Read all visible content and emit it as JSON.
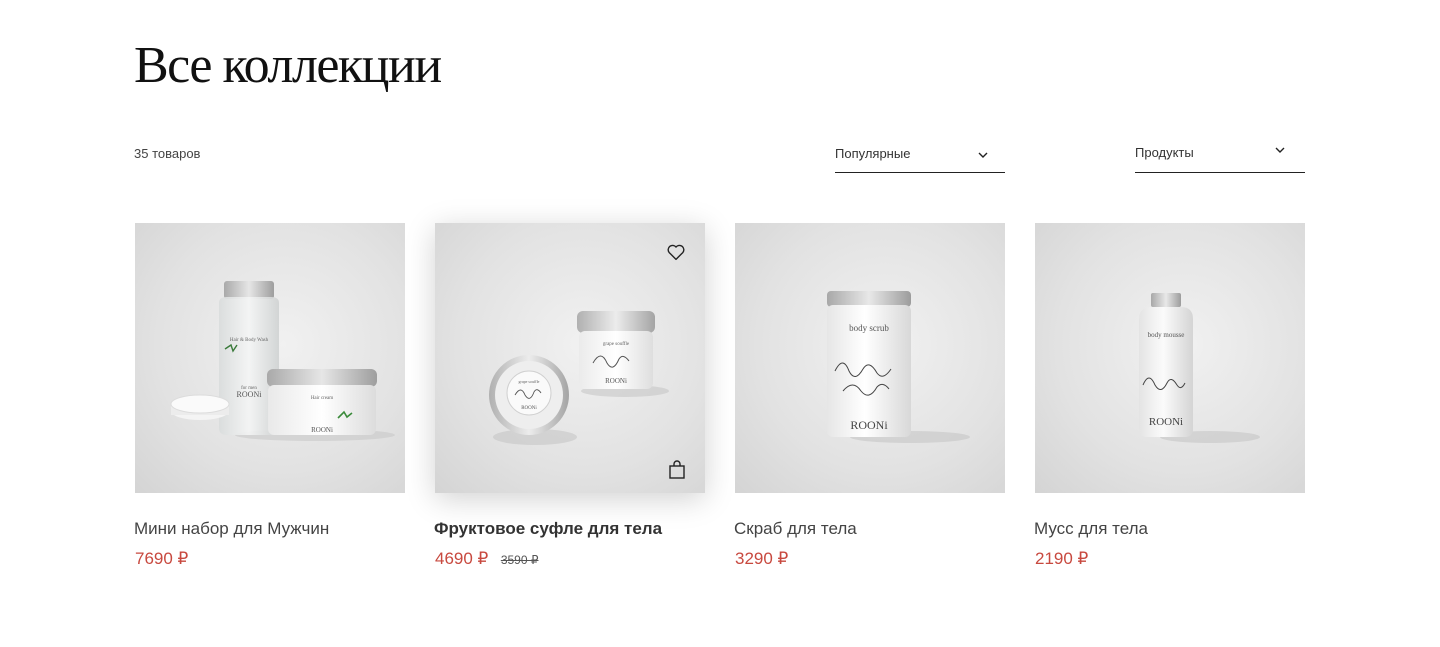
{
  "page": {
    "title": "Все коллекции"
  },
  "toolbar": {
    "count": "35 товаров",
    "sort": {
      "value": "Популярные",
      "icon": "chevron-down-icon"
    },
    "category": {
      "value": "Продукты",
      "icon": "chevron-down-icon"
    }
  },
  "products": [
    {
      "name": "Мини набор для Мужчин",
      "price": "7690 ₽",
      "image": "men-mini-set-image",
      "labels": [
        "Hair & Body Wash",
        "for men",
        "ROONi",
        "Hair cream",
        "ROONi"
      ]
    },
    {
      "name": "Фруктовое суфле для тела",
      "price": "4690 ₽",
      "old_price": "3590 ₽",
      "image": "body-souffle-image",
      "labels": [
        "grape souffle",
        "ROONi",
        "grape souffle",
        "ROONi"
      ],
      "icons": [
        "heart-icon",
        "shopping-bag-icon"
      ]
    },
    {
      "name": "Скраб для тела",
      "price": "3290 ₽",
      "image": "body-scrub-image",
      "labels": [
        "body scrub",
        "ROONi"
      ]
    },
    {
      "name": "Мусс для тела",
      "price": "2190 ₽",
      "image": "body-mousse-image",
      "labels": [
        "body mousse",
        "ROONi"
      ]
    }
  ],
  "colors": {
    "accent_price": "#c8493f",
    "text": "#333333",
    "background": "#ffffff",
    "image_bg": "#e2e2e2"
  }
}
